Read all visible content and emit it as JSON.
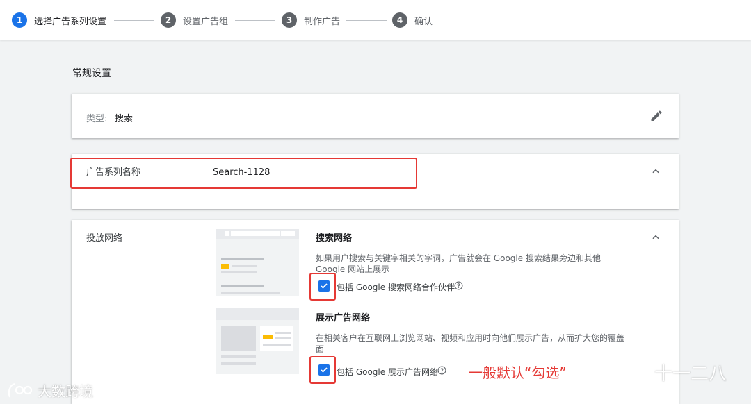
{
  "stepper": {
    "steps": [
      {
        "num": "1",
        "label": "选择广告系列设置"
      },
      {
        "num": "2",
        "label": "设置广告组"
      },
      {
        "num": "3",
        "label": "制作广告"
      },
      {
        "num": "4",
        "label": "确认"
      }
    ]
  },
  "general": {
    "title": "常规设置",
    "type_label": "类型:",
    "type_value": "搜索"
  },
  "campaign_name": {
    "label": "广告系列名称",
    "value": "Search-1128"
  },
  "network": {
    "label": "投放网络",
    "search": {
      "heading": "搜索网络",
      "description": "如果用户搜索与关键字相关的字词，广告就会在 Google 搜索结果旁边和其他 Google 网站上展示",
      "checkbox_label": "包括 Google 搜索网络合作伙伴",
      "checked": true
    },
    "display": {
      "heading": "展示广告网络",
      "description": "在相关客户在互联网上浏览网站、视频和应用时向他们展示广告，从而扩大您的覆盖面",
      "checkbox_label": "包括 Google 展示广告网络",
      "checked": true
    }
  },
  "annotation": "一般默认“勾选”",
  "watermarks": {
    "left": "大数跨境",
    "right": "十一二八"
  },
  "colors": {
    "accent": "#1a73e8",
    "annotation_red": "#e53935"
  }
}
